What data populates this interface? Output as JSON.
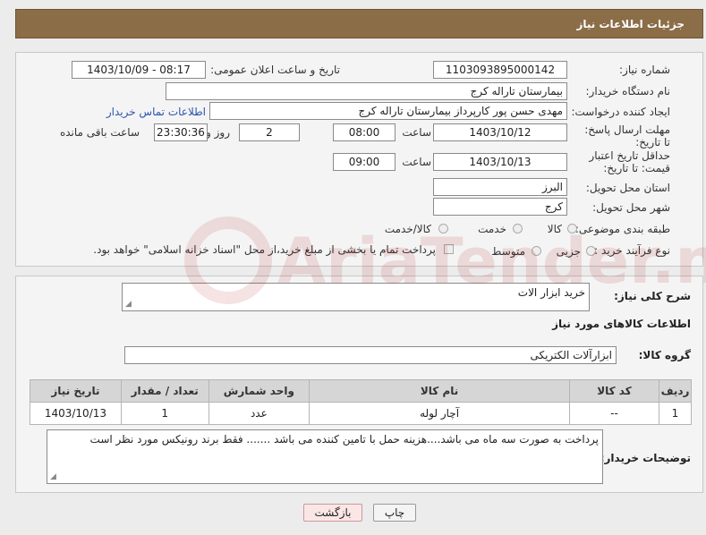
{
  "header": {
    "title": "جزئیات اطلاعات نیاز"
  },
  "form": {
    "need_number_label": "شماره نیاز:",
    "need_number": "1103093895000142",
    "announce_label": "تاریخ و ساعت اعلان عمومی:",
    "announce_value": "1403/10/09 - 08:17",
    "buyer_org_label": "نام دستگاه خریدار:",
    "buyer_org": "بیمارستان تاراله کرج",
    "creator_label": "ایجاد کننده درخواست:",
    "creator": "مهدی حسن پور کارپرداز بیمارستان تاراله کرج",
    "contact_link": "اطلاعات تماس خریدار",
    "deadline_label": "مهلت ارسال پاسخ: تا تاریخ:",
    "deadline_date": "1403/10/12",
    "time_label": "ساعت",
    "deadline_time": "08:00",
    "days_value": "2",
    "days_label": "روز و",
    "remaining_time": "23:30:36",
    "remaining_label": "ساعت باقی مانده",
    "price_validity_label": "حداقل تاریخ اعتبار قیمت: تا تاریخ:",
    "price_validity_date": "1403/10/13",
    "price_validity_time": "09:00",
    "province_label": "استان محل تحویل:",
    "province": "البرز",
    "city_label": "شهر محل تحویل:",
    "city": "کرج",
    "category_label": "طبقه بندی موضوعی:",
    "category_options": [
      "کالا",
      "خدمت",
      "کالا/خدمت"
    ],
    "process_label": "نوع فرآیند خرید :",
    "process_options": [
      "جزیی",
      "متوسط"
    ],
    "payment_note": "پرداخت تمام یا بخشی از مبلغ خرید،از محل \"اسناد خزانه اسلامی\" خواهد بود."
  },
  "details": {
    "description_label": "شرح کلی نیاز:",
    "description": "خرید ابزار الات",
    "goods_info_title": "اطلاعات کالاهای مورد نیاز",
    "goods_group_label": "گروه کالا:",
    "goods_group": "ابزارآلات الکتریکی",
    "table": {
      "headers": [
        "ردیف",
        "کد کالا",
        "نام کالا",
        "واحد شمارش",
        "تعداد / مقدار",
        "تاریخ نیاز"
      ],
      "rows": [
        [
          "1",
          "--",
          "آچار لوله",
          "عدد",
          "1",
          "1403/10/13"
        ]
      ]
    },
    "buyer_notes_label": "توضیحات خریدار:",
    "buyer_notes": "پرداخت به صورت سه ماه می باشد....هزینه حمل با  تامین کننده می باشد ....... فقط برند رونیکس مورد نظر است"
  },
  "buttons": {
    "print": "چاپ",
    "back": "بازگشت"
  },
  "watermark": {
    "text": "AriaTender.neT"
  }
}
